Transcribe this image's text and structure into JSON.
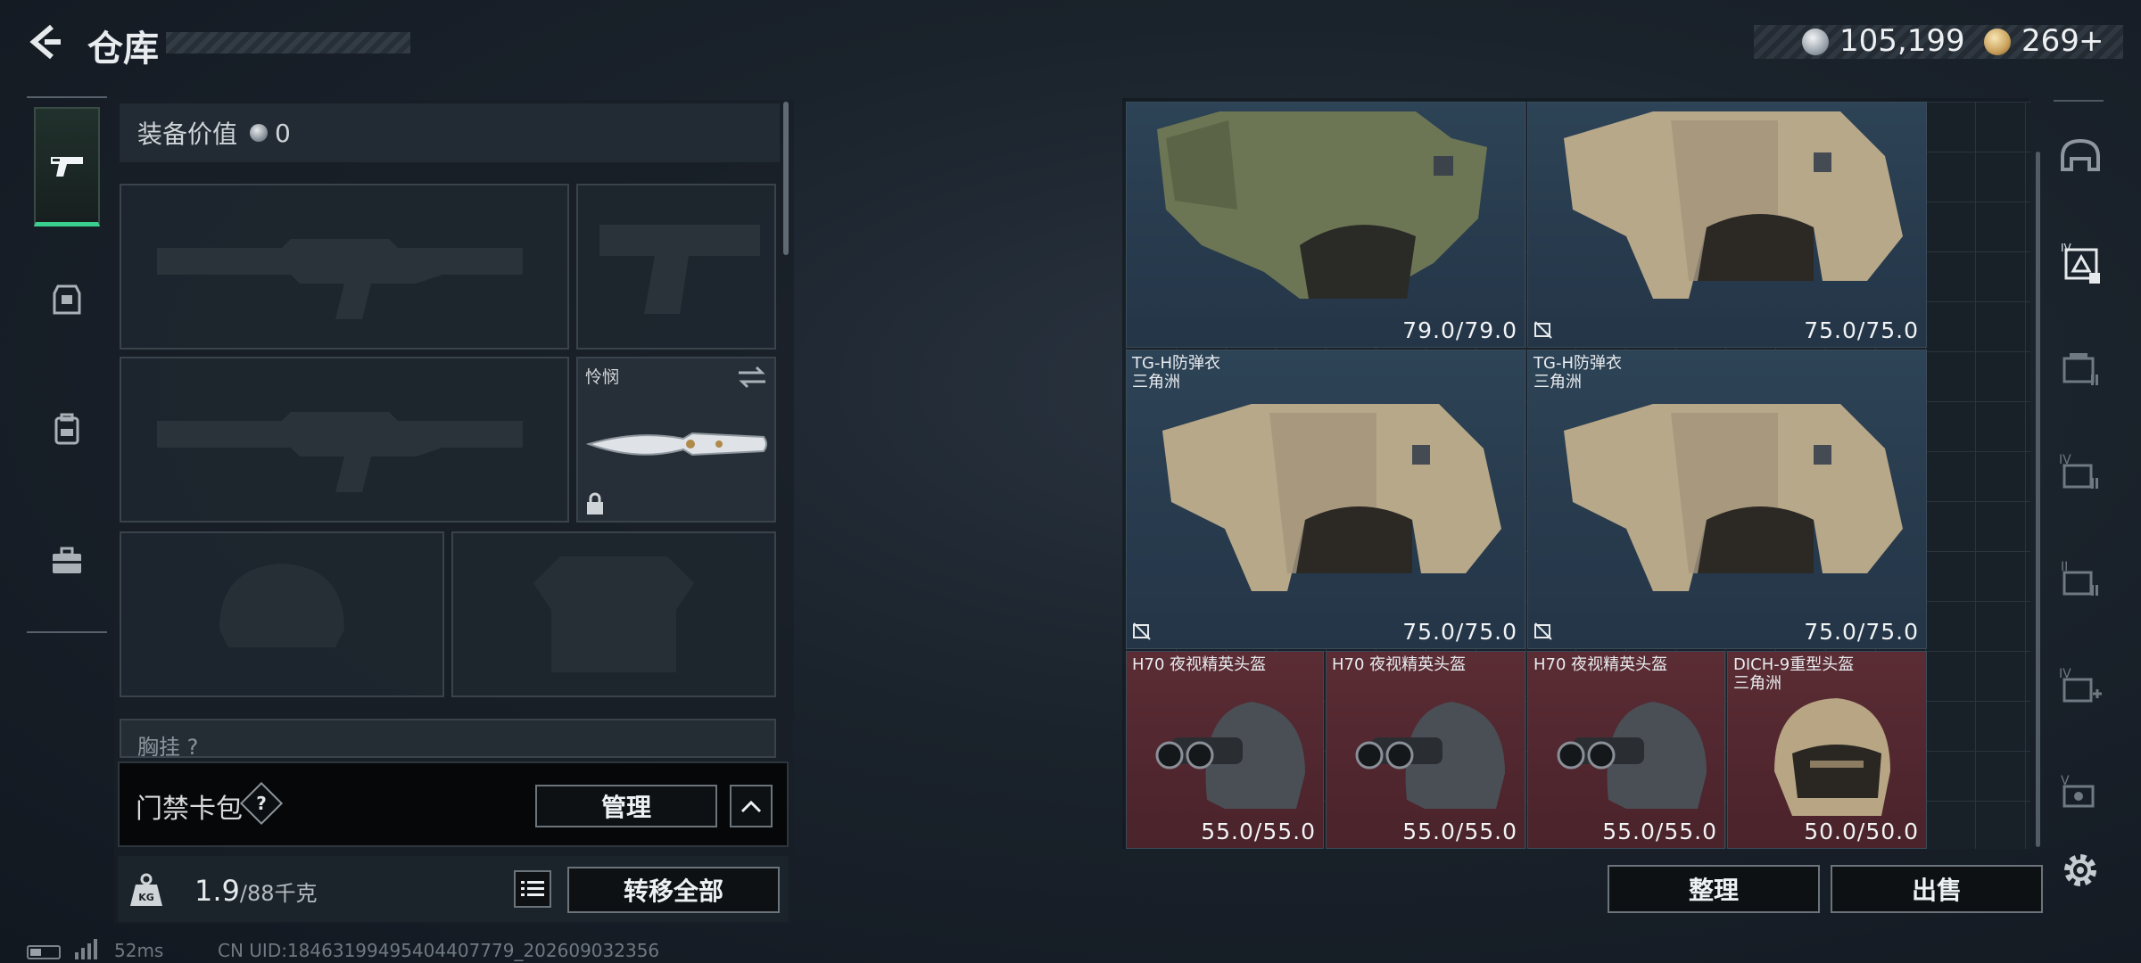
{
  "header": {
    "title": "仓库",
    "currency_silver": "105,199",
    "currency_gold": "269",
    "currency_gold_plus": "+"
  },
  "sidebar": {
    "items": [
      {
        "name": "weapons",
        "icon": "pistol-icon",
        "active": true
      },
      {
        "name": "armor",
        "icon": "vest-icon",
        "active": false
      },
      {
        "name": "backpack",
        "icon": "backpack-icon",
        "active": false
      },
      {
        "name": "supplies",
        "icon": "briefcase-icon",
        "active": false
      }
    ]
  },
  "equipment": {
    "value_label": "装备价值",
    "value_amount": "0",
    "knife_label": "怜悯",
    "chest_label_partial": "胸挂 ?",
    "card_wallet_label": "门禁卡包",
    "card_wallet_help": "?",
    "manage_label": "管理",
    "weight_value": "1.9",
    "weight_max": "/88千克",
    "weight_unit_icon": "KG",
    "transfer_all_label": "转移全部"
  },
  "storage": {
    "items": [
      {
        "name": "",
        "durability": "79.0/79.0",
        "rarity": "blue",
        "bound": false
      },
      {
        "name": "",
        "durability": "75.0/75.0",
        "rarity": "blue",
        "bound": true
      },
      {
        "name": "TG-H防弹衣\n三角洲",
        "durability": "75.0/75.0",
        "rarity": "blue",
        "bound": true
      },
      {
        "name": "TG-H防弹衣\n三角洲",
        "durability": "75.0/75.0",
        "rarity": "blue",
        "bound": true
      },
      {
        "name": "H70 夜视精英头盔",
        "durability": "55.0/55.0",
        "rarity": "red",
        "bound": false
      },
      {
        "name": "H70 夜视精英头盔",
        "durability": "55.0/55.0",
        "rarity": "red",
        "bound": false
      },
      {
        "name": "H70 夜视精英头盔",
        "durability": "55.0/55.0",
        "rarity": "red",
        "bound": false
      },
      {
        "name": "DICH-9重型头盔\n三角洲",
        "durability": "50.0/50.0",
        "rarity": "red",
        "bound": false
      }
    ],
    "sort_label": "整理",
    "sell_label": "出售"
  },
  "filters": [
    {
      "icon": "helmet-filter-icon"
    },
    {
      "icon": "armor-tier-iv-filter-icon",
      "label": "IV"
    },
    {
      "icon": "storage-filter-icon"
    },
    {
      "icon": "tier-iv-storage-filter-icon",
      "label": "IV"
    },
    {
      "icon": "tier-ii-storage-filter-icon",
      "label": "II"
    },
    {
      "icon": "tier-iv-add-filter-icon",
      "label": "IV"
    },
    {
      "icon": "tier-v-filter-icon",
      "label": "V"
    },
    {
      "icon": "settings-gear-icon"
    }
  ],
  "footer": {
    "ping": "52ms",
    "uid": "CN UID:18463199495404407779_202609032356"
  },
  "colors": {
    "accent_green": "#39d08f",
    "rarity_blue": "#2d4356",
    "rarity_red": "#5b2c34"
  }
}
